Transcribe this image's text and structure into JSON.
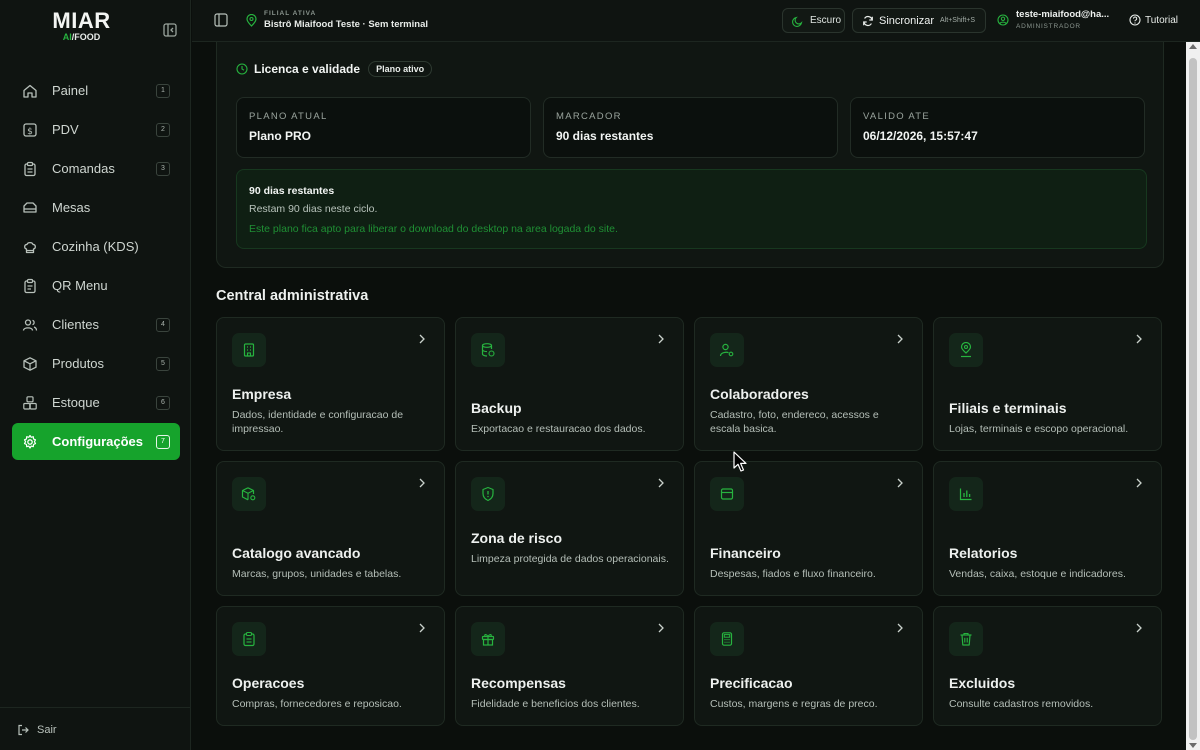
{
  "brand": {
    "main": "MIAR",
    "sub_ai": "AI",
    "sub_rest": "/FOOD"
  },
  "sidebar": {
    "items": [
      {
        "label": "Painel",
        "shortcut": "1"
      },
      {
        "label": "PDV",
        "shortcut": "2"
      },
      {
        "label": "Comandas",
        "shortcut": "3"
      },
      {
        "label": "Mesas",
        "shortcut": ""
      },
      {
        "label": "Cozinha (KDS)",
        "shortcut": ""
      },
      {
        "label": "QR Menu",
        "shortcut": ""
      },
      {
        "label": "Clientes",
        "shortcut": "4"
      },
      {
        "label": "Produtos",
        "shortcut": "5"
      },
      {
        "label": "Estoque",
        "shortcut": "6"
      },
      {
        "label": "Configurações",
        "shortcut": "7"
      }
    ],
    "logout_label": "Sair"
  },
  "topbar": {
    "filial_label": "FILIAL ATIVA",
    "filial_value": "Bistrô Miaifood Teste · Sem terminal",
    "theme_label": "Escuro",
    "sync_label": "Sincronizar",
    "sync_shortcut": "Alt+Shift+S",
    "user_name": "teste-miaifood@ha...",
    "user_role": "ADMINISTRADOR",
    "tutorial_label": "Tutorial"
  },
  "license": {
    "title": "Licenca e validade",
    "badge": "Plano ativo",
    "boxes": [
      {
        "label": "PLANO ATUAL",
        "value": "Plano PRO"
      },
      {
        "label": "MARCADOR",
        "value": "90 dias restantes"
      },
      {
        "label": "VALIDO ATE",
        "value": "06/12/2026, 15:57:47"
      }
    ],
    "note_title": "90 dias restantes",
    "note_text": "Restam 90 dias neste ciclo.",
    "note_highlight": "Este plano fica apto para liberar o download do desktop na area logada do site."
  },
  "admin": {
    "title": "Central administrativa",
    "cards": [
      {
        "title": "Empresa",
        "desc": "Dados, identidade e configuracao de impressao.",
        "icon": "building-icon"
      },
      {
        "title": "Backup",
        "desc": "Exportacao e restauracao dos dados.",
        "icon": "database-icon"
      },
      {
        "title": "Colaboradores",
        "desc": "Cadastro, foto, endereco, acessos e escala basica.",
        "icon": "user-gear-icon"
      },
      {
        "title": "Filiais e terminais",
        "desc": "Lojas, terminais e escopo operacional.",
        "icon": "map-pin-user-icon"
      },
      {
        "title": "Catalogo avancado",
        "desc": "Marcas, grupos, unidades e tabelas.",
        "icon": "box-gear-icon"
      },
      {
        "title": "Zona de risco",
        "desc": "Limpeza protegida de dados operacionais.",
        "icon": "shield-alert-icon"
      },
      {
        "title": "Financeiro",
        "desc": "Despesas, fiados e fluxo financeiro.",
        "icon": "wallet-icon"
      },
      {
        "title": "Relatorios",
        "desc": "Vendas, caixa, estoque e indicadores.",
        "icon": "bar-chart-icon"
      },
      {
        "title": "Operacoes",
        "desc": "Compras, fornecedores e reposicao.",
        "icon": "clipboard-icon"
      },
      {
        "title": "Recompensas",
        "desc": "Fidelidade e beneficios dos clientes.",
        "icon": "gift-icon"
      },
      {
        "title": "Precificacao",
        "desc": "Custos, margens e regras de preco.",
        "icon": "calculator-icon"
      },
      {
        "title": "Excluidos",
        "desc": "Consulte cadastros removidos.",
        "icon": "trash-icon"
      }
    ]
  },
  "colors": {
    "accent": "#16a32c",
    "background": "#0b0f0c",
    "card": "#101612"
  }
}
